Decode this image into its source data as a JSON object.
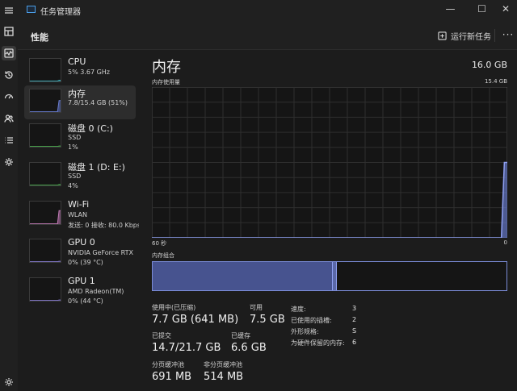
{
  "window": {
    "title": "任务管理器",
    "controls": [
      "—",
      "☐",
      "✕"
    ]
  },
  "nav": {
    "icons": [
      "menu-icon",
      "processes-icon",
      "performance-icon",
      "app-history-icon",
      "startup-apps-icon",
      "users-icon",
      "details-icon",
      "services-icon",
      "settings-icon"
    ],
    "active": "performance-icon"
  },
  "header": {
    "title": "性能",
    "run_task_label": "运行新任务",
    "more_label": "···"
  },
  "resources": [
    {
      "name": "CPU",
      "sub1": "5% 3.67 GHz",
      "sub2": "",
      "color": "#3fb7c4",
      "selected": false,
      "level": 0.05
    },
    {
      "name": "内存",
      "sub1": "7.8/15.4 GB (51%)",
      "sub2": "",
      "color": "#6b7fd6",
      "selected": true,
      "level": 0.51
    },
    {
      "name": "磁盘 0 (C:)",
      "sub1": "SSD",
      "sub2": "1%",
      "color": "#4caf50",
      "selected": false,
      "level": 0.01
    },
    {
      "name": "磁盘 1 (D: E:)",
      "sub1": "SSD",
      "sub2": "4%",
      "color": "#4caf50",
      "selected": false,
      "level": 0.04
    },
    {
      "name": "Wi-Fi",
      "sub1": "WLAN",
      "sub2": "发送: 0 接收: 80.0 Kbps",
      "color": "#c77dbb",
      "selected": false,
      "level": 0.6
    },
    {
      "name": "GPU 0",
      "sub1": "NVIDIA GeForce RTX",
      "sub2": "0% (39 °C)",
      "color": "#8a7fd6",
      "selected": false,
      "level": 0.0
    },
    {
      "name": "GPU 1",
      "sub1": "AMD Radeon(TM)",
      "sub2": "0% (44 °C)",
      "color": "#8a7fd6",
      "selected": false,
      "level": 0.0
    }
  ],
  "memory": {
    "title": "内存",
    "total": "16.0 GB",
    "chart_label": "内存使用量",
    "chart_max": "15.4 GB",
    "axis_left": "60 秒",
    "axis_right": "0",
    "composition_label": "内存组合",
    "composition": {
      "in_use_fraction": 0.51,
      "modified_fraction": 0.01,
      "in_use_color": "#47538f",
      "modified_color": "#5a68a8",
      "free_color": "#151515"
    },
    "stats": {
      "in_use_label": "使用中(已压缩)",
      "in_use_value": "7.7 GB (641 MB)",
      "available_label": "可用",
      "available_value": "7.5 GB",
      "committed_label": "已提交",
      "committed_value": "14.7/21.7 GB",
      "cached_label": "已缓存",
      "cached_value": "6.6 GB",
      "paged_pool_label": "分页缓冲池",
      "paged_pool_value": "691 MB",
      "nonpaged_pool_label": "非分页缓冲池",
      "nonpaged_pool_value": "514 MB"
    },
    "specs": [
      {
        "label": "速度:",
        "value": "3"
      },
      {
        "label": "已使用的插槽:",
        "value": "2"
      },
      {
        "label": "外形规格:",
        "value": "S"
      },
      {
        "label": "为硬件保留的内存:",
        "value": "6"
      }
    ]
  },
  "chart_data": {
    "type": "area",
    "x": [
      60,
      1,
      0.5,
      0
    ],
    "values": [
      0,
      0,
      7.7,
      7.7
    ],
    "ylim": [
      0,
      15.4
    ],
    "xlabel": "",
    "ylabel": "",
    "color": "#6b7fd6"
  }
}
